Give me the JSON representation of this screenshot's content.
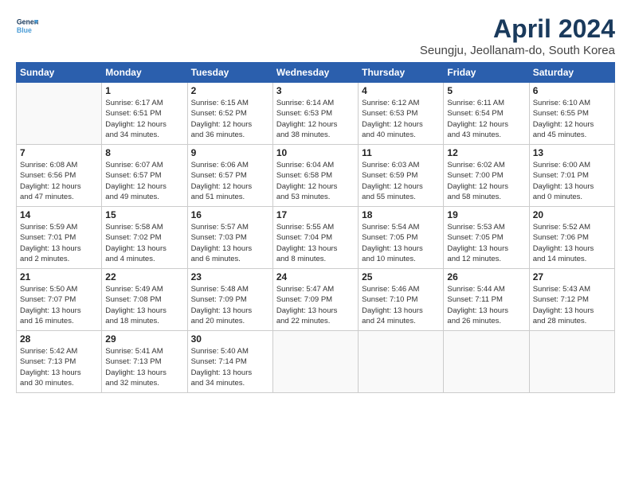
{
  "header": {
    "logo_line1": "General",
    "logo_line2": "Blue",
    "title": "April 2024",
    "subtitle": "Seungju, Jeollanam-do, South Korea"
  },
  "calendar": {
    "days_of_week": [
      "Sunday",
      "Monday",
      "Tuesday",
      "Wednesday",
      "Thursday",
      "Friday",
      "Saturday"
    ],
    "weeks": [
      [
        {
          "day": "",
          "info": ""
        },
        {
          "day": "1",
          "info": "Sunrise: 6:17 AM\nSunset: 6:51 PM\nDaylight: 12 hours\nand 34 minutes."
        },
        {
          "day": "2",
          "info": "Sunrise: 6:15 AM\nSunset: 6:52 PM\nDaylight: 12 hours\nand 36 minutes."
        },
        {
          "day": "3",
          "info": "Sunrise: 6:14 AM\nSunset: 6:53 PM\nDaylight: 12 hours\nand 38 minutes."
        },
        {
          "day": "4",
          "info": "Sunrise: 6:12 AM\nSunset: 6:53 PM\nDaylight: 12 hours\nand 40 minutes."
        },
        {
          "day": "5",
          "info": "Sunrise: 6:11 AM\nSunset: 6:54 PM\nDaylight: 12 hours\nand 43 minutes."
        },
        {
          "day": "6",
          "info": "Sunrise: 6:10 AM\nSunset: 6:55 PM\nDaylight: 12 hours\nand 45 minutes."
        }
      ],
      [
        {
          "day": "7",
          "info": "Sunrise: 6:08 AM\nSunset: 6:56 PM\nDaylight: 12 hours\nand 47 minutes."
        },
        {
          "day": "8",
          "info": "Sunrise: 6:07 AM\nSunset: 6:57 PM\nDaylight: 12 hours\nand 49 minutes."
        },
        {
          "day": "9",
          "info": "Sunrise: 6:06 AM\nSunset: 6:57 PM\nDaylight: 12 hours\nand 51 minutes."
        },
        {
          "day": "10",
          "info": "Sunrise: 6:04 AM\nSunset: 6:58 PM\nDaylight: 12 hours\nand 53 minutes."
        },
        {
          "day": "11",
          "info": "Sunrise: 6:03 AM\nSunset: 6:59 PM\nDaylight: 12 hours\nand 55 minutes."
        },
        {
          "day": "12",
          "info": "Sunrise: 6:02 AM\nSunset: 7:00 PM\nDaylight: 12 hours\nand 58 minutes."
        },
        {
          "day": "13",
          "info": "Sunrise: 6:00 AM\nSunset: 7:01 PM\nDaylight: 13 hours\nand 0 minutes."
        }
      ],
      [
        {
          "day": "14",
          "info": "Sunrise: 5:59 AM\nSunset: 7:01 PM\nDaylight: 13 hours\nand 2 minutes."
        },
        {
          "day": "15",
          "info": "Sunrise: 5:58 AM\nSunset: 7:02 PM\nDaylight: 13 hours\nand 4 minutes."
        },
        {
          "day": "16",
          "info": "Sunrise: 5:57 AM\nSunset: 7:03 PM\nDaylight: 13 hours\nand 6 minutes."
        },
        {
          "day": "17",
          "info": "Sunrise: 5:55 AM\nSunset: 7:04 PM\nDaylight: 13 hours\nand 8 minutes."
        },
        {
          "day": "18",
          "info": "Sunrise: 5:54 AM\nSunset: 7:05 PM\nDaylight: 13 hours\nand 10 minutes."
        },
        {
          "day": "19",
          "info": "Sunrise: 5:53 AM\nSunset: 7:05 PM\nDaylight: 13 hours\nand 12 minutes."
        },
        {
          "day": "20",
          "info": "Sunrise: 5:52 AM\nSunset: 7:06 PM\nDaylight: 13 hours\nand 14 minutes."
        }
      ],
      [
        {
          "day": "21",
          "info": "Sunrise: 5:50 AM\nSunset: 7:07 PM\nDaylight: 13 hours\nand 16 minutes."
        },
        {
          "day": "22",
          "info": "Sunrise: 5:49 AM\nSunset: 7:08 PM\nDaylight: 13 hours\nand 18 minutes."
        },
        {
          "day": "23",
          "info": "Sunrise: 5:48 AM\nSunset: 7:09 PM\nDaylight: 13 hours\nand 20 minutes."
        },
        {
          "day": "24",
          "info": "Sunrise: 5:47 AM\nSunset: 7:09 PM\nDaylight: 13 hours\nand 22 minutes."
        },
        {
          "day": "25",
          "info": "Sunrise: 5:46 AM\nSunset: 7:10 PM\nDaylight: 13 hours\nand 24 minutes."
        },
        {
          "day": "26",
          "info": "Sunrise: 5:44 AM\nSunset: 7:11 PM\nDaylight: 13 hours\nand 26 minutes."
        },
        {
          "day": "27",
          "info": "Sunrise: 5:43 AM\nSunset: 7:12 PM\nDaylight: 13 hours\nand 28 minutes."
        }
      ],
      [
        {
          "day": "28",
          "info": "Sunrise: 5:42 AM\nSunset: 7:13 PM\nDaylight: 13 hours\nand 30 minutes."
        },
        {
          "day": "29",
          "info": "Sunrise: 5:41 AM\nSunset: 7:13 PM\nDaylight: 13 hours\nand 32 minutes."
        },
        {
          "day": "30",
          "info": "Sunrise: 5:40 AM\nSunset: 7:14 PM\nDaylight: 13 hours\nand 34 minutes."
        },
        {
          "day": "",
          "info": ""
        },
        {
          "day": "",
          "info": ""
        },
        {
          "day": "",
          "info": ""
        },
        {
          "day": "",
          "info": ""
        }
      ]
    ]
  }
}
